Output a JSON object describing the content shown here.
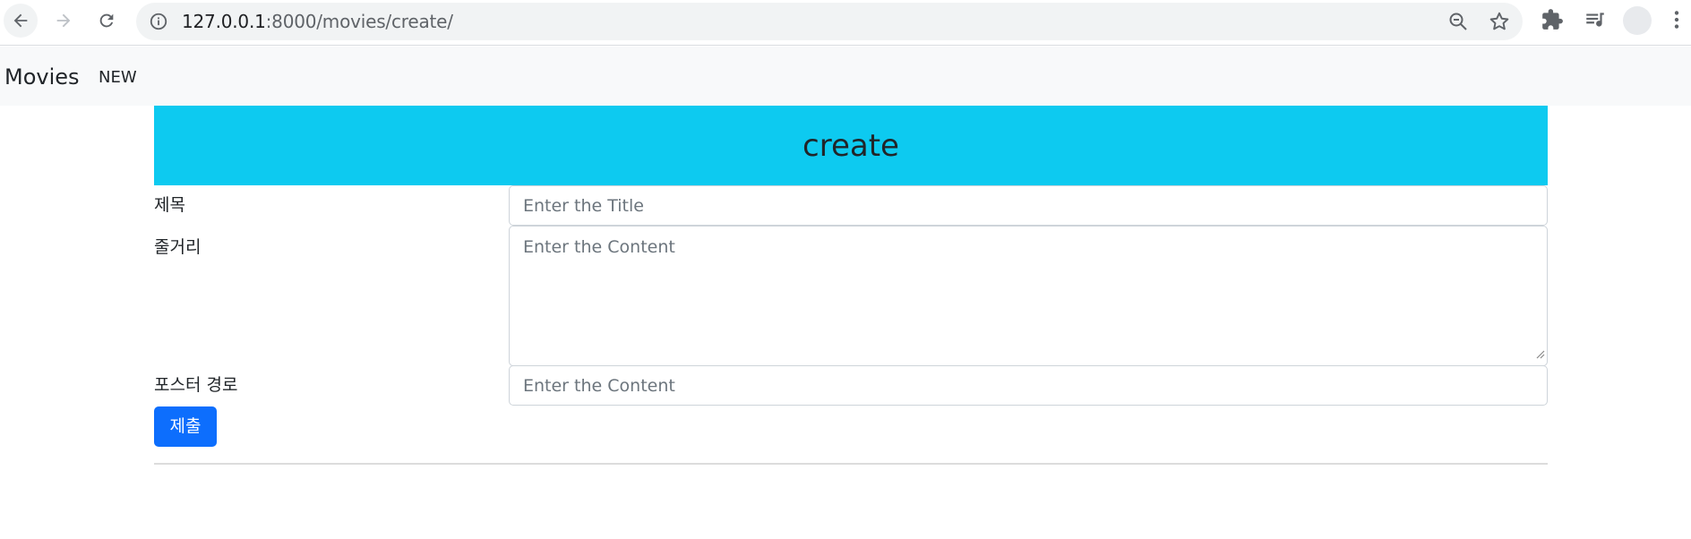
{
  "browser": {
    "url_host": "127.0.0.1",
    "url_path": ":8000/movies/create/",
    "icons": [
      "back-arrow-icon",
      "forward-arrow-icon",
      "reload-icon",
      "site-info-icon",
      "zoom-out-icon",
      "bookmark-star-icon",
      "extensions-puzzle-icon",
      "reading-list-icon",
      "profile-avatar-icon",
      "more-menu-icon"
    ]
  },
  "navbar": {
    "brand": "Movies",
    "links": [
      "NEW"
    ]
  },
  "main": {
    "heading": "create",
    "form": {
      "title_label": "제목",
      "title_placeholder": "Enter the Title",
      "content_label": "줄거리",
      "content_placeholder": "Enter the Content",
      "poster_label": "포스터 경로",
      "poster_placeholder": "Enter the Content",
      "submit_label": "제출"
    }
  },
  "colors": {
    "header_bg": "#0dcaf0",
    "submit_bg": "#0d6efd",
    "navbar_bg": "#f8f9fa"
  }
}
